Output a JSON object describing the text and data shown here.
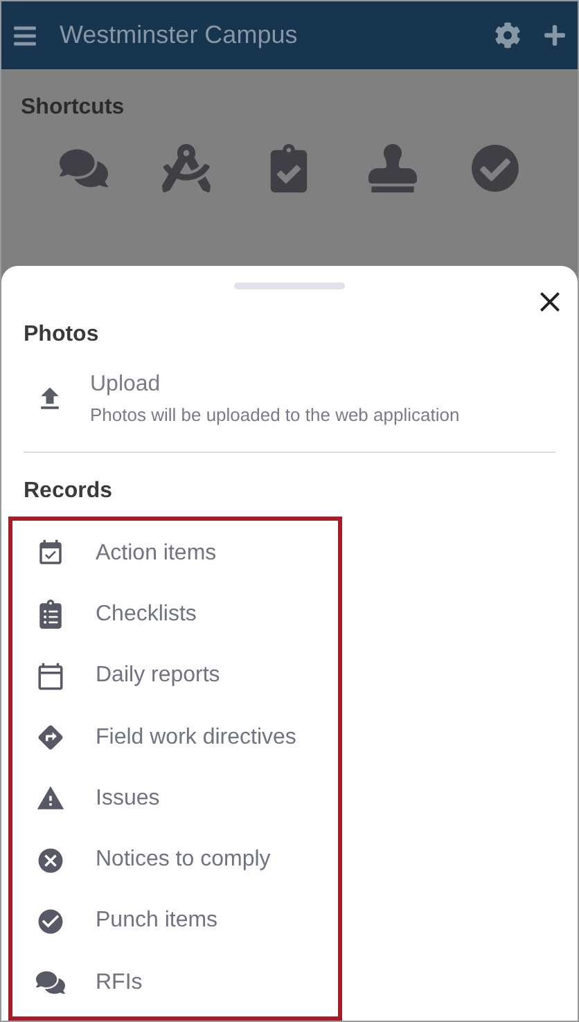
{
  "header": {
    "title": "Westminster Campus"
  },
  "shortcuts": {
    "title": "Shortcuts"
  },
  "sheet": {
    "sections": [
      {
        "title": "Photos",
        "kind": "upload",
        "items": [
          {
            "label": "Upload",
            "description": "Photos will be uploaded to the web application"
          }
        ]
      },
      {
        "title": "Records",
        "kind": "records",
        "highlighted": true,
        "items": [
          {
            "label": "Action items"
          },
          {
            "label": "Checklists"
          },
          {
            "label": "Daily reports"
          },
          {
            "label": "Field work directives"
          },
          {
            "label": "Issues"
          },
          {
            "label": "Notices to comply"
          },
          {
            "label": "Punch items"
          },
          {
            "label": "RFIs"
          }
        ]
      }
    ]
  }
}
